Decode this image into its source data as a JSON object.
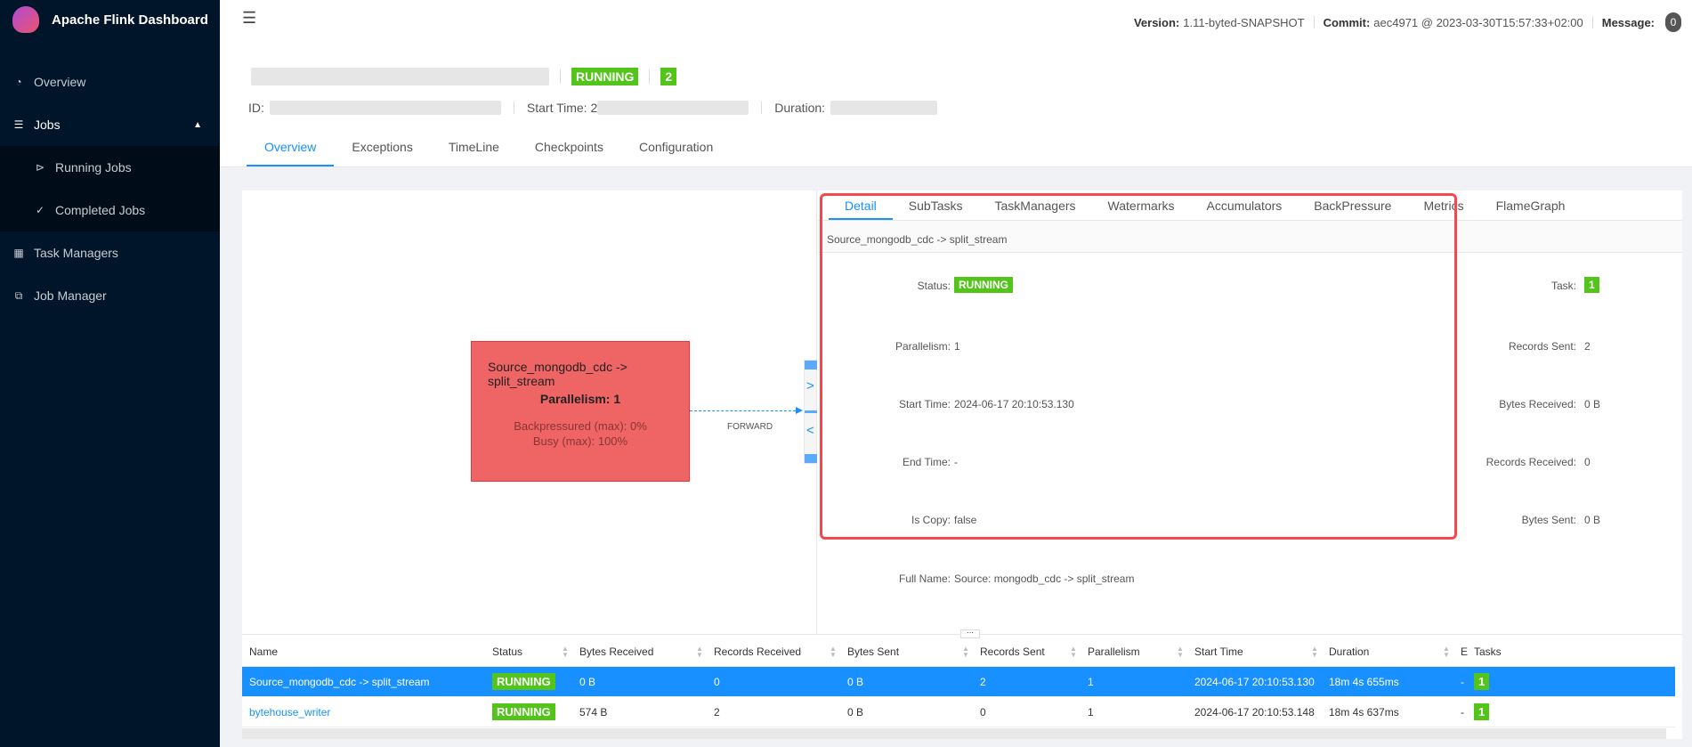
{
  "app": {
    "title": "Apache Flink Dashboard"
  },
  "sidebar": {
    "items": [
      {
        "label": "Overview",
        "icon": "dashboard-icon"
      },
      {
        "label": "Jobs",
        "icon": "list-icon"
      },
      {
        "label": "Running Jobs",
        "icon": "play-circle-icon"
      },
      {
        "label": "Completed Jobs",
        "icon": "check-circle-icon"
      },
      {
        "label": "Task Managers",
        "icon": "schedule-icon"
      },
      {
        "label": "Job Manager",
        "icon": "build-icon"
      }
    ]
  },
  "header": {
    "version_label": "Version:",
    "version": "1.11-byted-SNAPSHOT",
    "commit_label": "Commit:",
    "commit": "aec4971 @ 2023-03-30T15:57:33+02:00",
    "message_label": "Message:",
    "message_count": "0"
  },
  "job": {
    "status": "RUNNING",
    "task_count": "2",
    "id_label": "ID:",
    "start_label": "Start Time:",
    "start_prefix": "2",
    "duration_label": "Duration:",
    "tabs": [
      "Overview",
      "Exceptions",
      "TimeLine",
      "Checkpoints",
      "Configuration"
    ]
  },
  "graph": {
    "node": {
      "title": "Source_mongodb_cdc -> split_stream",
      "parallelism": "Parallelism: 1",
      "backpressured": "Backpressured (max): 0%",
      "busy": "Busy (max): 100%"
    },
    "edge_label": "FORWARD"
  },
  "detail": {
    "tabs": [
      "Detail",
      "SubTasks",
      "TaskManagers",
      "Watermarks",
      "Accumulators",
      "BackPressure",
      "Metrics",
      "FlameGraph"
    ],
    "vertex_name": "Source_mongodb_cdc -> split_stream",
    "left": [
      {
        "label": "Status:",
        "value": "RUNNING"
      },
      {
        "label": "Parallelism:",
        "value": "1"
      },
      {
        "label": "Start Time:",
        "value": "2024-06-17 20:10:53.130"
      },
      {
        "label": "End Time:",
        "value": "-"
      },
      {
        "label": "Is Copy:",
        "value": "false"
      },
      {
        "label": "Full Name:",
        "value": "Source: mongodb_cdc -> split_stream"
      }
    ],
    "right": [
      {
        "label": "Task:",
        "value": "1"
      },
      {
        "label": "Records Sent:",
        "value": "2"
      },
      {
        "label": "Bytes Received:",
        "value": "0 B"
      },
      {
        "label": "Records Received:",
        "value": "0"
      },
      {
        "label": "Bytes Sent:",
        "value": "0 B"
      }
    ]
  },
  "table": {
    "columns": [
      "Name",
      "Status",
      "Bytes Received",
      "Records Received",
      "Bytes Sent",
      "Records Sent",
      "Parallelism",
      "Start Time",
      "Duration",
      "E",
      "Tasks"
    ],
    "rows": [
      [
        "Source_mongodb_cdc -> split_stream",
        "RUNNING",
        "0 B",
        "0",
        "0 B",
        "2",
        "1",
        "2024-06-17 20:10:53.130",
        "18m 4s 655ms",
        "-",
        "1"
      ],
      [
        "bytehouse_writer",
        "RUNNING",
        "574 B",
        "2",
        "0 B",
        "0",
        "1",
        "2024-06-17 20:10:53.148",
        "18m 4s 637ms",
        "-",
        "1"
      ]
    ]
  },
  "colors": {
    "accent": "#1890ff",
    "running": "#52c41a",
    "sidebar": "#001529",
    "node": "#ef6464",
    "highlight": "#f5484c"
  }
}
